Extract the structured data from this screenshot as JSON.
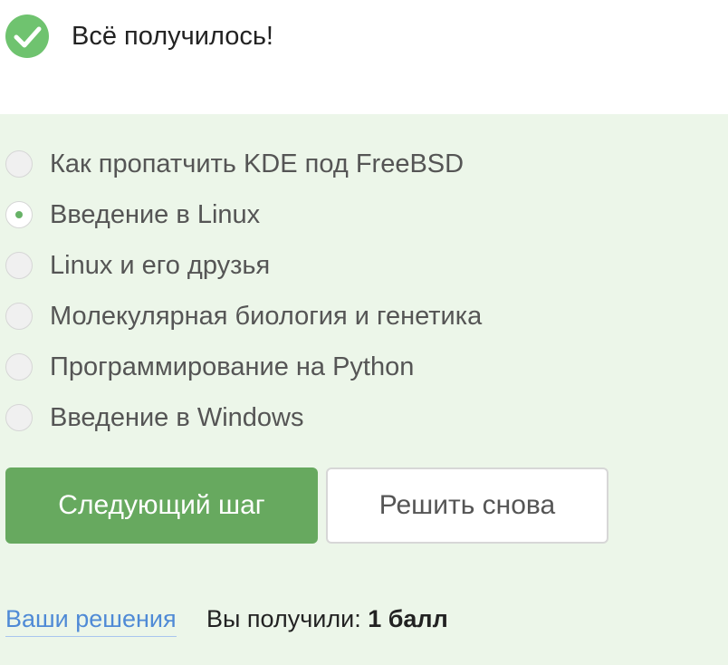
{
  "header": {
    "icon": "check-circle-icon",
    "success_text": "Всё получилось!"
  },
  "options": [
    {
      "label": "Как пропатчить KDE под FreeBSD",
      "selected": false
    },
    {
      "label": "Введение в Linux",
      "selected": true
    },
    {
      "label": "Linux и его друзья",
      "selected": false
    },
    {
      "label": "Молекулярная биология и генетика",
      "selected": false
    },
    {
      "label": "Программирование на Python",
      "selected": false
    },
    {
      "label": "Введение в Windows",
      "selected": false
    }
  ],
  "buttons": {
    "next_step": "Следующий шаг",
    "solve_again": "Решить снова"
  },
  "footer": {
    "solutions_link": "Ваши решения",
    "score_prefix": "Вы получили:",
    "score_value": "1 балл"
  },
  "colors": {
    "success_green": "#6fc36f",
    "panel_bg": "#ecf6e9",
    "primary_button": "#67a95f",
    "link": "#4f8ad6"
  }
}
